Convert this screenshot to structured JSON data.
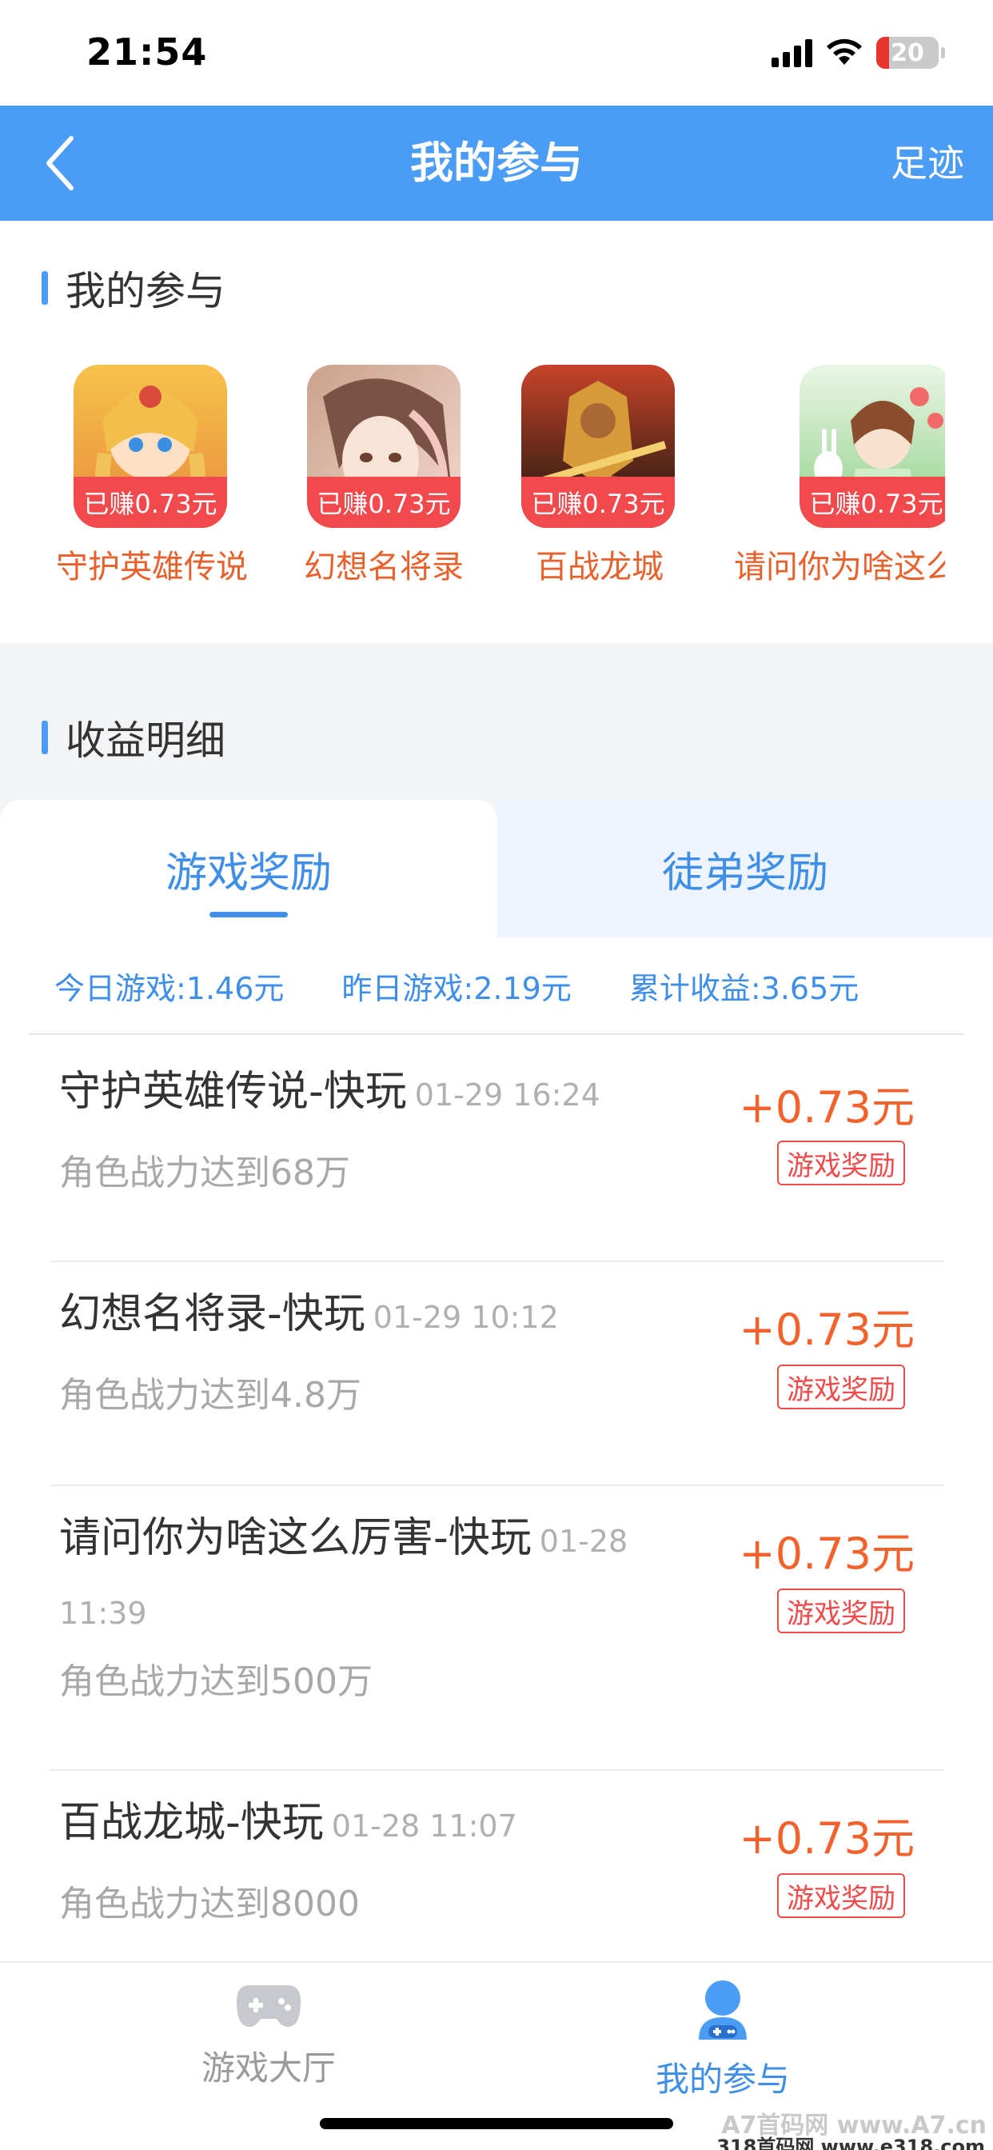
{
  "status_bar": {
    "time": "21:54",
    "battery": "20"
  },
  "nav": {
    "title": "我的参与",
    "right_label": "足迹"
  },
  "participation": {
    "heading": "我的参与",
    "games": [
      {
        "name": "守护英雄传说",
        "earned": "已赚0.73元"
      },
      {
        "name": "幻想名将录",
        "earned": "已赚0.73元"
      },
      {
        "name": "百战龙城",
        "earned": "已赚0.73元"
      },
      {
        "name": "请问你为啥这么",
        "earned": "已赚0.73元"
      }
    ]
  },
  "earnings": {
    "heading": "收益明细",
    "tabs": [
      {
        "label": "游戏奖励"
      },
      {
        "label": "徒弟奖励"
      }
    ],
    "summary": {
      "today": "今日游戏:1.46元",
      "yesterday": "昨日游戏:2.19元",
      "total": "累计收益:3.65元"
    },
    "records": [
      {
        "title": "守护英雄传说-快玩",
        "date": "01-29 16:24",
        "desc": "角色战力达到68万",
        "amount": "+0.73元",
        "tag": "游戏奖励"
      },
      {
        "title": "幻想名将录-快玩",
        "date": "01-29 10:12",
        "desc": "角色战力达到4.8万",
        "amount": "+0.73元",
        "tag": "游戏奖励"
      },
      {
        "title": "请问你为啥这么厉害-快玩",
        "date": "01-28 11:39",
        "desc": "角色战力达到500万",
        "amount": "+0.73元",
        "tag": "游戏奖励"
      },
      {
        "title": "百战龙城-快玩",
        "date": "01-28 11:07",
        "desc": "角色战力达到8000",
        "amount": "+0.73元",
        "tag": "游戏奖励"
      }
    ]
  },
  "tab_bar": {
    "items": [
      {
        "label": "游戏大厅"
      },
      {
        "label": "我的参与"
      }
    ]
  },
  "watermark": {
    "line1": "A7首码网 www.A7.cn",
    "line2": "318首码网 www.e318.com"
  },
  "colors": {
    "primary": "#4a9cf5",
    "accent_red": "#f1494c",
    "amount_orange": "#f3622c",
    "game_name_orange": "#e8612c",
    "tab_inactive_bg": "#edf4fe"
  }
}
